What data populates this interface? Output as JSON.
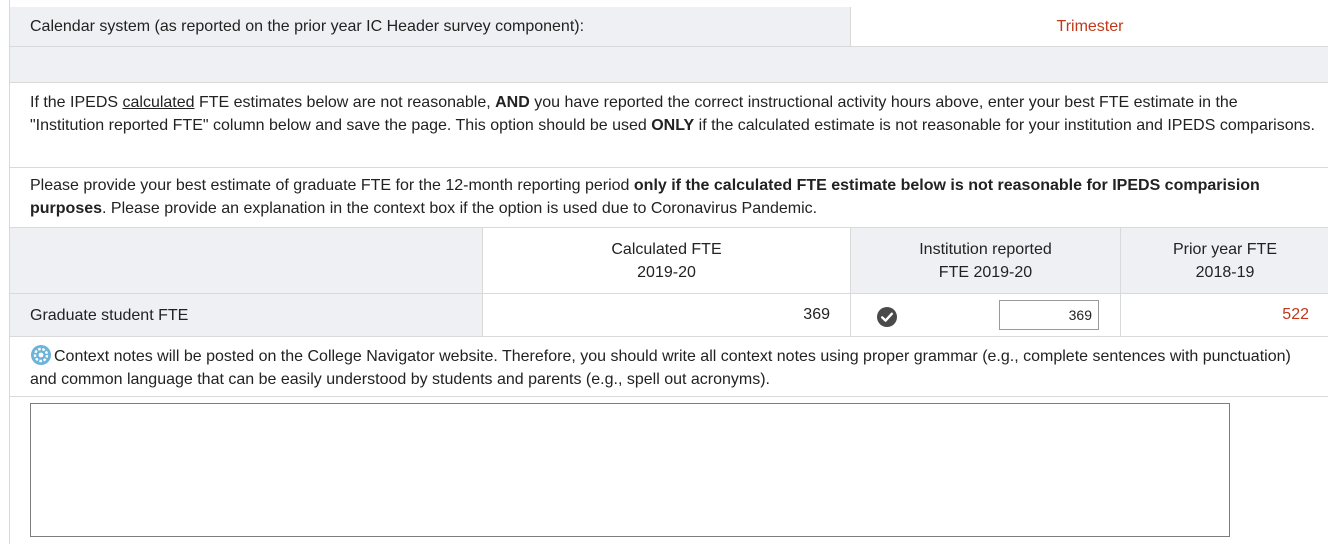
{
  "calendar": {
    "label": "Calendar system (as reported on the prior year IC Header survey component):",
    "value": "Trimester"
  },
  "instructions": {
    "p1_part1": "If the IPEDS ",
    "p1_underlined": "calculated",
    "p1_part2": " FTE estimates below are not reasonable, ",
    "p1_bold1": "AND",
    "p1_part3": " you have reported the correct instructional activity hours above, enter your best FTE estimate in the \"Institution reported FTE\" column below and save the page. This option should be used ",
    "p1_bold2": "ONLY",
    "p1_part4": " if the calculated estimate is not reasonable for your institution and IPEDS comparisons.",
    "p2_part1": "Please provide your best estimate of graduate FTE for the 12-month reporting period ",
    "p2_bold": "only if the calculated FTE estimate below is not reasonable for IPEDS comparision purposes",
    "p2_part2": ". Please provide an explanation in the context box if the option is used due to Coronavirus Pandemic."
  },
  "table": {
    "headers": {
      "calculated_line1": "Calculated FTE",
      "calculated_line2": "2019-20",
      "reported_line1": "Institution reported",
      "reported_line2": "FTE 2019-20",
      "prior_line1": "Prior year FTE",
      "prior_line2": "2018-19"
    },
    "row": {
      "label": "Graduate student FTE",
      "calculated": "369",
      "reported_value": "369",
      "prior": "522"
    }
  },
  "context": {
    "note": "Context notes will be posted on the College Navigator website. Therefore, you should write all context notes using proper grammar (e.g., complete sentences with punctuation) and common language that can be easily understood by students and parents (e.g., spell out acronyms).",
    "textarea_value": ""
  },
  "colors": {
    "accent_red": "#c0391b",
    "row_gray": "#eef0f4"
  }
}
